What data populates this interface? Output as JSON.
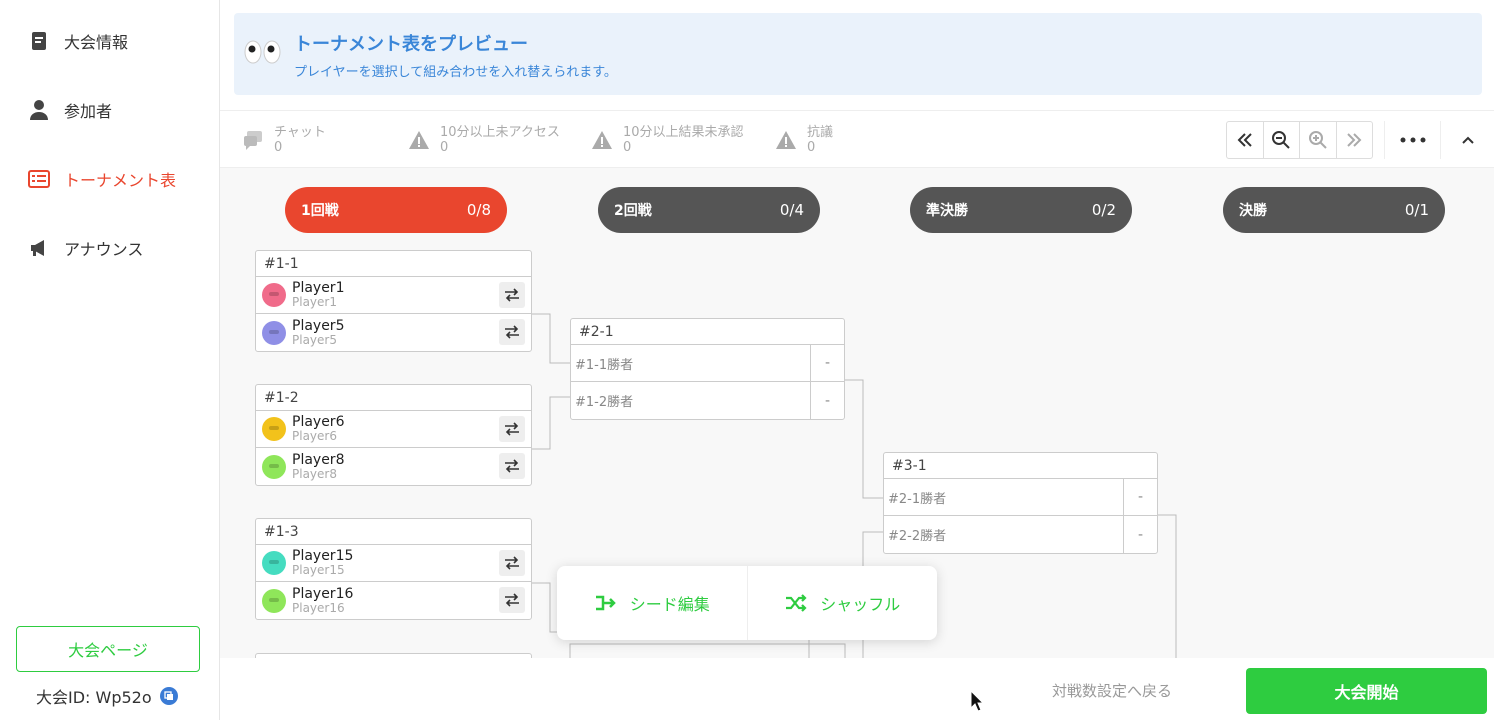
{
  "sidebar": {
    "items": [
      {
        "label": "大会情報",
        "icon": "document-icon"
      },
      {
        "label": "参加者",
        "icon": "person-icon"
      },
      {
        "label": "トーナメント表",
        "icon": "bracket-icon",
        "active": true
      },
      {
        "label": "アナウンス",
        "icon": "megaphone-icon"
      }
    ],
    "page_button": "大会ページ",
    "tournament_id": "大会ID: Wp52o"
  },
  "banner": {
    "title": "トーナメント表をプレビュー",
    "subtitle": "プレイヤーを選択して組み合わせを入れ替えられます。"
  },
  "toolbar": {
    "stats": [
      {
        "label": "チャット",
        "value": "0",
        "icon": "chat-icon"
      },
      {
        "label": "10分以上未アクセス",
        "value": "0",
        "icon": "warning-icon"
      },
      {
        "label": "10分以上結果未承認",
        "value": "0",
        "icon": "warning-icon"
      },
      {
        "label": "抗議",
        "value": "0",
        "icon": "warning-icon"
      }
    ]
  },
  "rounds": [
    {
      "name": "1回戦",
      "count": "0/8",
      "color": "#e9462e"
    },
    {
      "name": "2回戦",
      "count": "0/4",
      "color": "#555555"
    },
    {
      "name": "準決勝",
      "count": "0/2",
      "color": "#555555"
    },
    {
      "name": "決勝",
      "count": "0/1",
      "color": "#555555"
    }
  ],
  "round1": [
    {
      "id": "#1-1",
      "players": [
        {
          "name": "Player1",
          "sub": "Player1",
          "color": "#f06b8a"
        },
        {
          "name": "Player5",
          "sub": "Player5",
          "color": "#8f8fe6"
        }
      ]
    },
    {
      "id": "#1-2",
      "players": [
        {
          "name": "Player6",
          "sub": "Player6",
          "color": "#f2c21b"
        },
        {
          "name": "Player8",
          "sub": "Player8",
          "color": "#8fe65a"
        }
      ]
    },
    {
      "id": "#1-3",
      "players": [
        {
          "name": "Player15",
          "sub": "Player15",
          "color": "#45dcc0"
        },
        {
          "name": "Player16",
          "sub": "Player16",
          "color": "#8fe65a"
        }
      ]
    }
  ],
  "round2": [
    {
      "id": "#2-1",
      "slots": [
        {
          "name": "#1-1勝者",
          "score": "-"
        },
        {
          "name": "#1-2勝者",
          "score": "-"
        }
      ]
    }
  ],
  "round3": [
    {
      "id": "#3-1",
      "slots": [
        {
          "name": "#2-1勝者",
          "score": "-"
        },
        {
          "name": "#2-2勝者",
          "score": "-"
        }
      ]
    }
  ],
  "popup": {
    "seed_edit": "シード編集",
    "shuffle": "シャッフル"
  },
  "footer": {
    "back": "対戦数設定へ戻る",
    "start": "大会開始"
  },
  "colors": {
    "accent": "#e9462e",
    "green": "#2ecc40",
    "blue": "#3a86d8"
  }
}
